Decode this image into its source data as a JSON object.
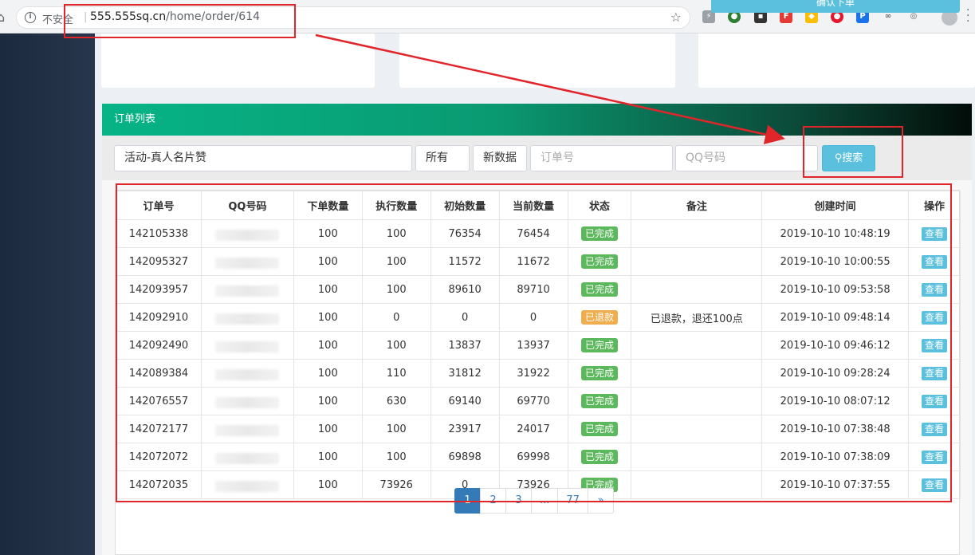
{
  "browser": {
    "insecure_label": "不安全",
    "url_host": "555.555sq.cn",
    "url_path": "/home/order/614"
  },
  "top": {
    "confirm_label": "确认下单"
  },
  "panel": {
    "title": "订单列表"
  },
  "filters": {
    "activity_value": "活动-真人名片赞",
    "status_value": "所有",
    "data_value": "新数据",
    "order_placeholder": "订单号",
    "qq_placeholder": "QQ号码",
    "search_label": "搜索"
  },
  "table": {
    "headers": [
      "订单号",
      "QQ号码",
      "下单数量",
      "执行数量",
      "初始数量",
      "当前数量",
      "状态",
      "备注",
      "创建时间",
      "操作"
    ],
    "rows": [
      {
        "id": "142105338",
        "qq": "1329349380",
        "qty": "100",
        "done": "100",
        "init": "76354",
        "cur": "76454",
        "status": "已完成",
        "status_type": "done",
        "note": "",
        "time": "2019-10-10 10:48:19",
        "action": "查看"
      },
      {
        "id": "142095327",
        "qq": "1064198",
        "qty": "100",
        "done": "100",
        "init": "11572",
        "cur": "11672",
        "status": "已完成",
        "status_type": "done",
        "note": "",
        "time": "2019-10-10 10:00:55",
        "action": "查看"
      },
      {
        "id": "142093957",
        "qq": "2054094918",
        "qty": "100",
        "done": "100",
        "init": "89610",
        "cur": "89710",
        "status": "已完成",
        "status_type": "done",
        "note": "",
        "time": "2019-10-10 09:53:58",
        "action": "查看"
      },
      {
        "id": "142092910",
        "qq": "307477038",
        "qty": "100",
        "done": "0",
        "init": "0",
        "cur": "0",
        "status": "已退款",
        "status_type": "refund",
        "note": "已退款，退还100点",
        "time": "2019-10-10 09:48:14",
        "action": "查看"
      },
      {
        "id": "142092490",
        "qq": "3230303203",
        "qty": "100",
        "done": "100",
        "init": "13837",
        "cur": "13937",
        "status": "已完成",
        "status_type": "done",
        "note": "",
        "time": "2019-10-10 09:46:12",
        "action": "查看"
      },
      {
        "id": "142089384",
        "qq": "2872181439",
        "qty": "100",
        "done": "110",
        "init": "31812",
        "cur": "31922",
        "status": "已完成",
        "status_type": "done",
        "note": "",
        "time": "2019-10-10 09:28:24",
        "action": "查看"
      },
      {
        "id": "142076557",
        "qq": "1722381889",
        "qty": "100",
        "done": "630",
        "init": "69140",
        "cur": "69770",
        "status": "已完成",
        "status_type": "done",
        "note": "",
        "time": "2019-10-10 08:07:12",
        "action": "查看"
      },
      {
        "id": "142072177",
        "qq": "2923169935",
        "qty": "100",
        "done": "100",
        "init": "23917",
        "cur": "24017",
        "status": "已完成",
        "status_type": "done",
        "note": "",
        "time": "2019-10-10 07:38:48",
        "action": "查看"
      },
      {
        "id": "142072072",
        "qq": "1393087805",
        "qty": "100",
        "done": "100",
        "init": "69898",
        "cur": "69998",
        "status": "已完成",
        "status_type": "done",
        "note": "",
        "time": "2019-10-10 07:38:09",
        "action": "查看"
      },
      {
        "id": "142072035",
        "qq": "2948261132",
        "qty": "100",
        "done": "73926",
        "init": "0",
        "cur": "73926",
        "status": "已完成",
        "status_type": "done",
        "note": "",
        "time": "2019-10-10 07:37:55",
        "action": "查看"
      }
    ]
  },
  "pagination": {
    "pages": [
      "1",
      "2",
      "3",
      "...",
      "77",
      "»"
    ],
    "active": "1"
  },
  "colors": {
    "header_gradient_start": "#06b486",
    "header_gradient_end": "#020c08",
    "annotation": "#e0252b",
    "done_badge": "#5cb85c",
    "refund_badge": "#f0ad4e",
    "info_button": "#5bc0de"
  }
}
